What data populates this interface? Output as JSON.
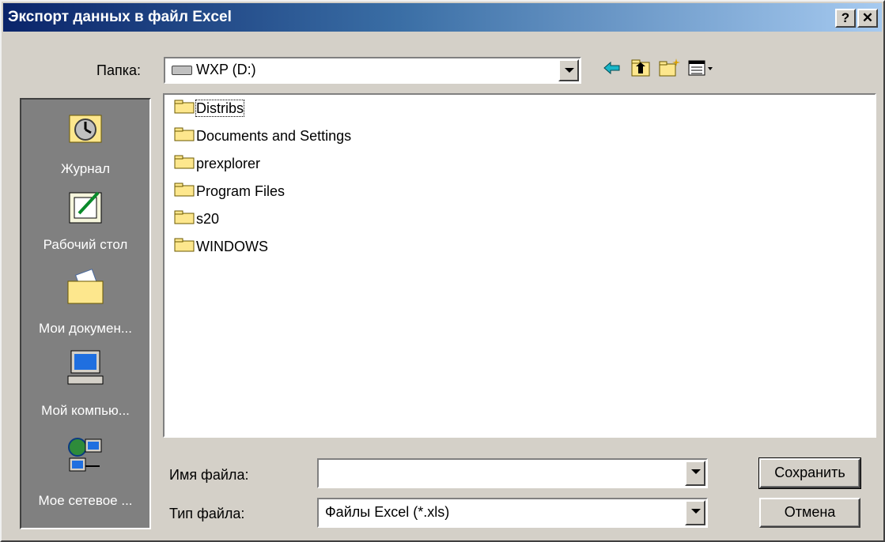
{
  "window": {
    "title": "Экспорт данных в файл Excel",
    "help_label": "?",
    "close_label": "✕"
  },
  "toolbar": {
    "folder_label": "Папка:",
    "folder_value": "WXP (D:)",
    "icons": [
      "back-icon",
      "up-folder-icon",
      "new-folder-icon",
      "view-menu-icon"
    ]
  },
  "places": [
    {
      "label": "Журнал",
      "icon": "history-icon"
    },
    {
      "label": "Рабочий стол",
      "icon": "desktop-icon"
    },
    {
      "label": "Мои докумен...",
      "icon": "my-documents-icon"
    },
    {
      "label": "Мой компью...",
      "icon": "my-computer-icon"
    },
    {
      "label": "Мое сетевое ...",
      "icon": "network-icon"
    }
  ],
  "files": [
    {
      "name": "Distribs"
    },
    {
      "name": "Documents and Settings"
    },
    {
      "name": "prexplorer"
    },
    {
      "name": "Program Files"
    },
    {
      "name": "s20"
    },
    {
      "name": "WINDOWS"
    }
  ],
  "form": {
    "filename_label": "Имя файла:",
    "filename_value": "",
    "filetype_label": "Тип файла:",
    "filetype_value": "Файлы Excel (*.xls)"
  },
  "buttons": {
    "save": "Сохранить",
    "cancel": "Отмена"
  },
  "colors": {
    "title_start": "#0a246a",
    "title_end": "#a6caf0",
    "face": "#d4d0c8",
    "places_bg": "#808080",
    "folder": "#fde78d"
  }
}
